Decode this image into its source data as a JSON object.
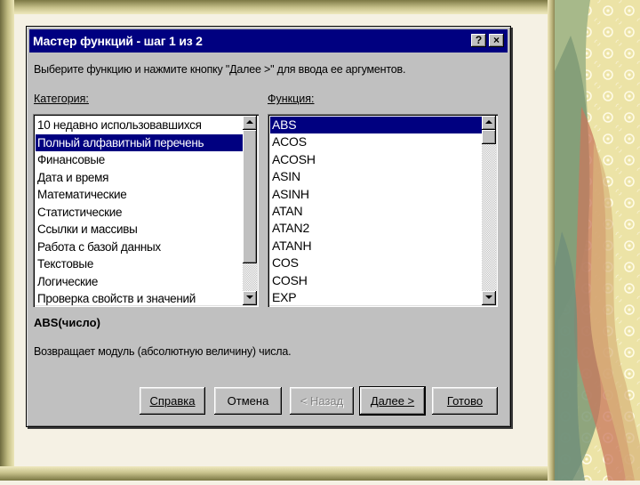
{
  "dialog": {
    "title": "Мастер функций - шаг 1 из 2",
    "help_button": "?",
    "close_button": "×",
    "instruction": "Выберите функцию и нажмите кнопку \"Далее >\" для ввода ее аргументов.",
    "category_label": "Категория:",
    "function_label": "Функция:",
    "categories": [
      {
        "label": "10 недавно использовавшихся",
        "selected": false
      },
      {
        "label": "Полный алфавитный перечень",
        "selected": true
      },
      {
        "label": "Финансовые",
        "selected": false
      },
      {
        "label": "Дата и время",
        "selected": false
      },
      {
        "label": "Математические",
        "selected": false
      },
      {
        "label": "Статистические",
        "selected": false
      },
      {
        "label": "Ссылки и массивы",
        "selected": false
      },
      {
        "label": "Работа с базой данных",
        "selected": false
      },
      {
        "label": "Текстовые",
        "selected": false
      },
      {
        "label": "Логические",
        "selected": false
      },
      {
        "label": "Проверка свойств и значений",
        "selected": false
      }
    ],
    "functions": [
      {
        "label": "ABS",
        "selected": true
      },
      {
        "label": "ACOS",
        "selected": false
      },
      {
        "label": "ACOSH",
        "selected": false
      },
      {
        "label": "ASIN",
        "selected": false
      },
      {
        "label": "ASINH",
        "selected": false
      },
      {
        "label": "ATAN",
        "selected": false
      },
      {
        "label": "ATAN2",
        "selected": false
      },
      {
        "label": "ATANH",
        "selected": false
      },
      {
        "label": "COS",
        "selected": false
      },
      {
        "label": "COSH",
        "selected": false
      },
      {
        "label": "EXP",
        "selected": false
      }
    ],
    "function_signature": "ABS(число)",
    "function_description": "Возвращает модуль (абсолютную величину) числа.",
    "buttons": {
      "help": "Справка",
      "cancel": "Отмена",
      "back": "< Назад",
      "next": "Далее >",
      "finish": "Готово"
    }
  },
  "colors": {
    "titlebar": "#000080",
    "selection": "#000080",
    "dialog_face": "#c0c0c0"
  }
}
